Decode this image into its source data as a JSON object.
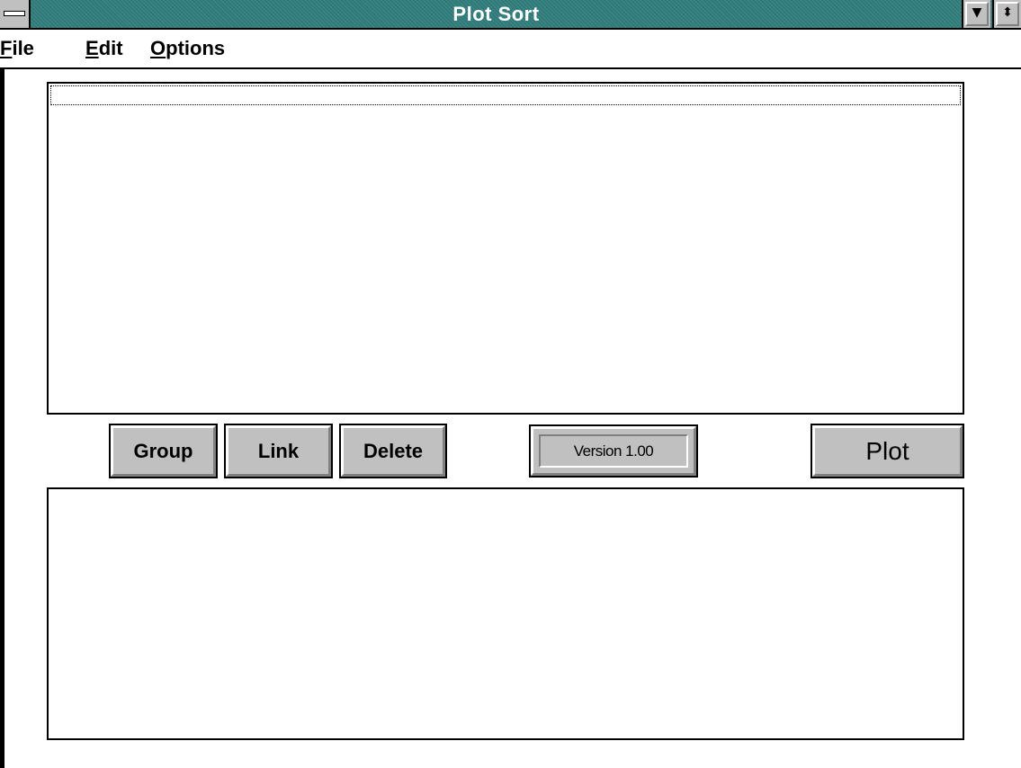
{
  "window": {
    "title": "Plot Sort",
    "title_bar_color": "#2e7a78",
    "system_menu_icon": "system-menu-icon",
    "minimize_glyph": "▼",
    "restore_glyph": "⬍"
  },
  "menu": {
    "file": {
      "mnemonic": "F",
      "rest": "ile"
    },
    "edit": {
      "mnemonic": "E",
      "rest": "dit"
    },
    "options": {
      "mnemonic": "O",
      "rest": "ptions"
    }
  },
  "buttons": {
    "group": "Group",
    "link": "Link",
    "delete": "Delete",
    "plot": "Plot"
  },
  "version": "Version 1.00",
  "lists": {
    "top_items": [],
    "bottom_items": []
  },
  "colors": {
    "face": "#c0c0c0",
    "highlight": "#ffffff",
    "shadow": "#808080"
  }
}
